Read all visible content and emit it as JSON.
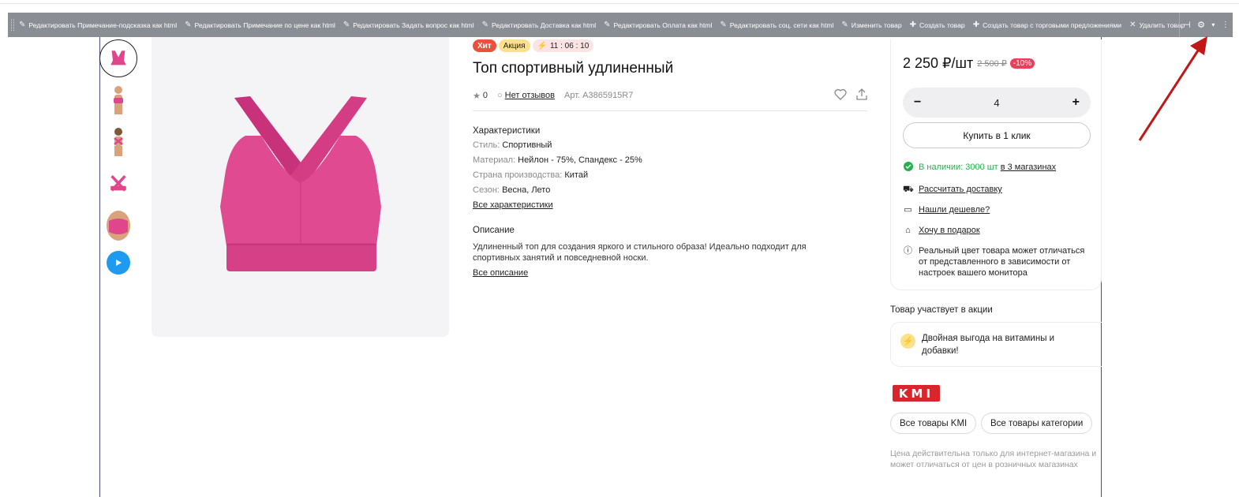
{
  "toolbar": {
    "items": [
      "Редактировать Примечание-подсказка как html",
      "Редактировать Примечание по цене как html",
      "Редактировать Задать вопрос как html",
      "Редактировать Доставка как html",
      "Редактировать Оплата как html",
      "Редактировать соц. сети как html",
      "Изменить товар",
      "Создать товар",
      "Создать товар с торговыми предложениями",
      "Удалить товар"
    ]
  },
  "product": {
    "badge_hit": "Хит",
    "badge_promo": "Акция",
    "timer": "11 : 06 : 10",
    "title": "Топ спортивный удлиненный",
    "rating": "0",
    "reviews": "Нет отзывов",
    "article": "Арт. A3865915R7"
  },
  "characteristics": {
    "heading": "Характеристики",
    "rows": [
      {
        "k": "Стиль:",
        "v": "Спортивный"
      },
      {
        "k": "Материал:",
        "v": "Нейлон - 75%, Спандекс - 25%"
      },
      {
        "k": "Страна производства:",
        "v": "Китай"
      },
      {
        "k": "Сезон:",
        "v": "Весна, Лето"
      }
    ],
    "all_link": "Все характеристики"
  },
  "description": {
    "heading": "Описание",
    "text": "Удлиненный топ для создания яркого и стильного образа! Идеально подходит для спортивных занятий и повседневной носки.",
    "all_link": "Все описание"
  },
  "buy": {
    "price": "2 250 ₽/шт",
    "old_price": "2 500 ₽",
    "discount": "-10%",
    "quantity": "4",
    "minus": "−",
    "plus": "+",
    "one_click": "Купить в 1 клик",
    "stock_green": "В наличии: 3000 шт",
    "stock_rest": "в 3 магазинах",
    "delivery": "Рассчитать доставку",
    "cheaper": "Нашли дешевле?",
    "gift": "Хочу в подарок",
    "color_note": "Реальный цвет товара может отличаться от представленного в зависимости от настроек вашего монитора"
  },
  "promo": {
    "heading": "Товар участвует в акции",
    "text": "Двойная выгода на витамины и добавки!"
  },
  "brand": {
    "logo": "KMI",
    "all_brand": "Все товары KMI",
    "all_category": "Все товары категории"
  },
  "note": "Цена действительна только для интернет-магазина и может отличаться от цен в розничных магазинах",
  "colors": {
    "accent_pink": "#e0468c",
    "toolbar": "#8a8e94",
    "hit": "#f04e3c",
    "discount": "#f03e5a",
    "stock": "#22b14c",
    "arrow": "#c01818"
  }
}
